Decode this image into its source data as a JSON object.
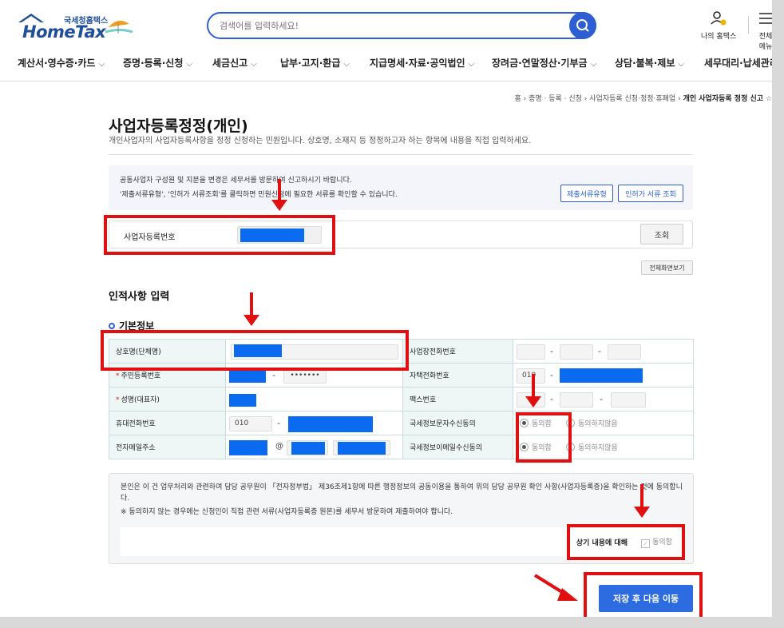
{
  "header": {
    "logo_small": "국세청홈택스",
    "logo_big": "HomeTax",
    "search_placeholder": "검색어를 입력하세요!",
    "my_hometax": "나의 홈택스",
    "all_menu": "전체메뉴"
  },
  "gnb": [
    "계산서·영수증·카드",
    "증명·등록·신청",
    "세금신고",
    "납부·고지·환급",
    "지급명세·자료·공익법인",
    "장려금·연말정산·기부금",
    "상담·불복·제보",
    "세무대리·납세관리"
  ],
  "breadcrumb": {
    "home": "홈",
    "l1": "증명 · 등록 · 신청",
    "l2": "사업자등록 신청·정정·휴폐업",
    "current": "개인 사업자등록 정정 신고"
  },
  "page": {
    "title": "사업자등록정정(개인)",
    "desc": "개인사업자의 사업자등록사항을 정정 신청하는 민원입니다. 상호명, 소재지 등 정정하고자 하는 항목에 내용을 직접 입력하세요."
  },
  "notice": {
    "line1": "공동사업자 구성원 및 지분을 변경은 세무서를 방문하여 신고하시기 바랍니다.",
    "line2": "'제출서류유형', '인허가 서류조회'를 클릭하면 민원신청에 필요한 서류를 확인할 수 있습니다.",
    "btn_docs": "제출서류유형",
    "btn_permit": "인허가 서류 조회"
  },
  "brn": {
    "label": "사업자등록번호",
    "lookup": "조회",
    "fullscreen": "전체화면보기"
  },
  "section_title": "인적사항 입력",
  "subsection_title": "기본정보",
  "form": {
    "trade_name": "상호명(단체명)",
    "biz_phone": "사업장전화번호",
    "rrn": "주민등록번호",
    "rrn_masked": "•••••••",
    "home_phone": "자택전화번호",
    "home_phone_prefix": "010",
    "rep_name": "성명(대표자)",
    "fax": "팩스번호",
    "mobile": "휴대전화번호",
    "mobile_prefix": "010",
    "sms_consent": "국세정보문자수신동의",
    "email": "전자메일주소",
    "at": "@",
    "email_consent": "국세정보이메일수신동의",
    "agree": "동의함",
    "disagree": "동의하지않음",
    "dash": "-"
  },
  "agreement": {
    "text1": "본인은 이 건 업무처리와 관련하여 담당 공무원이 「전자정부법」 제36조제1항에 따른 행정정보의 공동이용을 통하여 위의 담당 공무원 확인 사항(사업자등록증)을 확인하는 것에 동의합니다.",
    "text2": "※ 동의하지 않는 경우에는 신청인이 직접 관련 서류(사업자등록증 원본)를 세무서 방문하여 제출하여야 합니다.",
    "confirm_label": "상기 내용에 대해",
    "confirm_check": "동의함"
  },
  "save_button": "저장 후 다음 이동",
  "colors": {
    "brand_blue": "#2d5fd3",
    "mask_blue": "#0a6bf0",
    "annotation_red": "#e01010"
  }
}
